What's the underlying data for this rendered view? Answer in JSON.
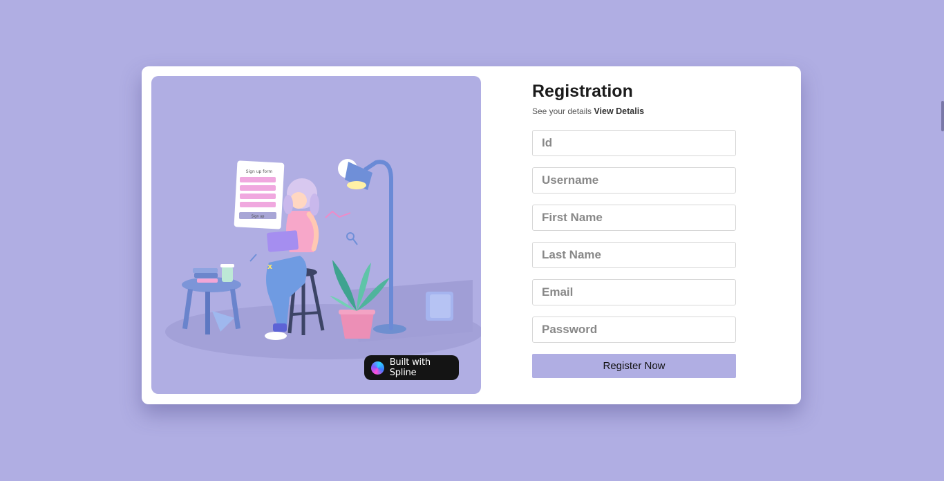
{
  "registration": {
    "title": "Registration",
    "subtitle_prefix": "See your details",
    "subtitle_link": "View Detalis",
    "fields": [
      {
        "placeholder": "Id",
        "value": ""
      },
      {
        "placeholder": "Username",
        "value": ""
      },
      {
        "placeholder": "First Name",
        "value": ""
      },
      {
        "placeholder": "Last Name",
        "value": ""
      },
      {
        "placeholder": "Email",
        "value": ""
      },
      {
        "placeholder": "Password",
        "value": ""
      }
    ],
    "submit_label": "Register Now"
  },
  "badge": {
    "label": "Built with Spline",
    "icon": "spline-logo-icon"
  },
  "illustration": {
    "icon": "person-with-laptop-scene",
    "form_card_title": "Sign up form",
    "form_card_button": "Sign up"
  },
  "colors": {
    "background": "#b0aee3",
    "card": "#ffffff",
    "accent": "#b0aee3",
    "badge_bg": "#141414"
  }
}
